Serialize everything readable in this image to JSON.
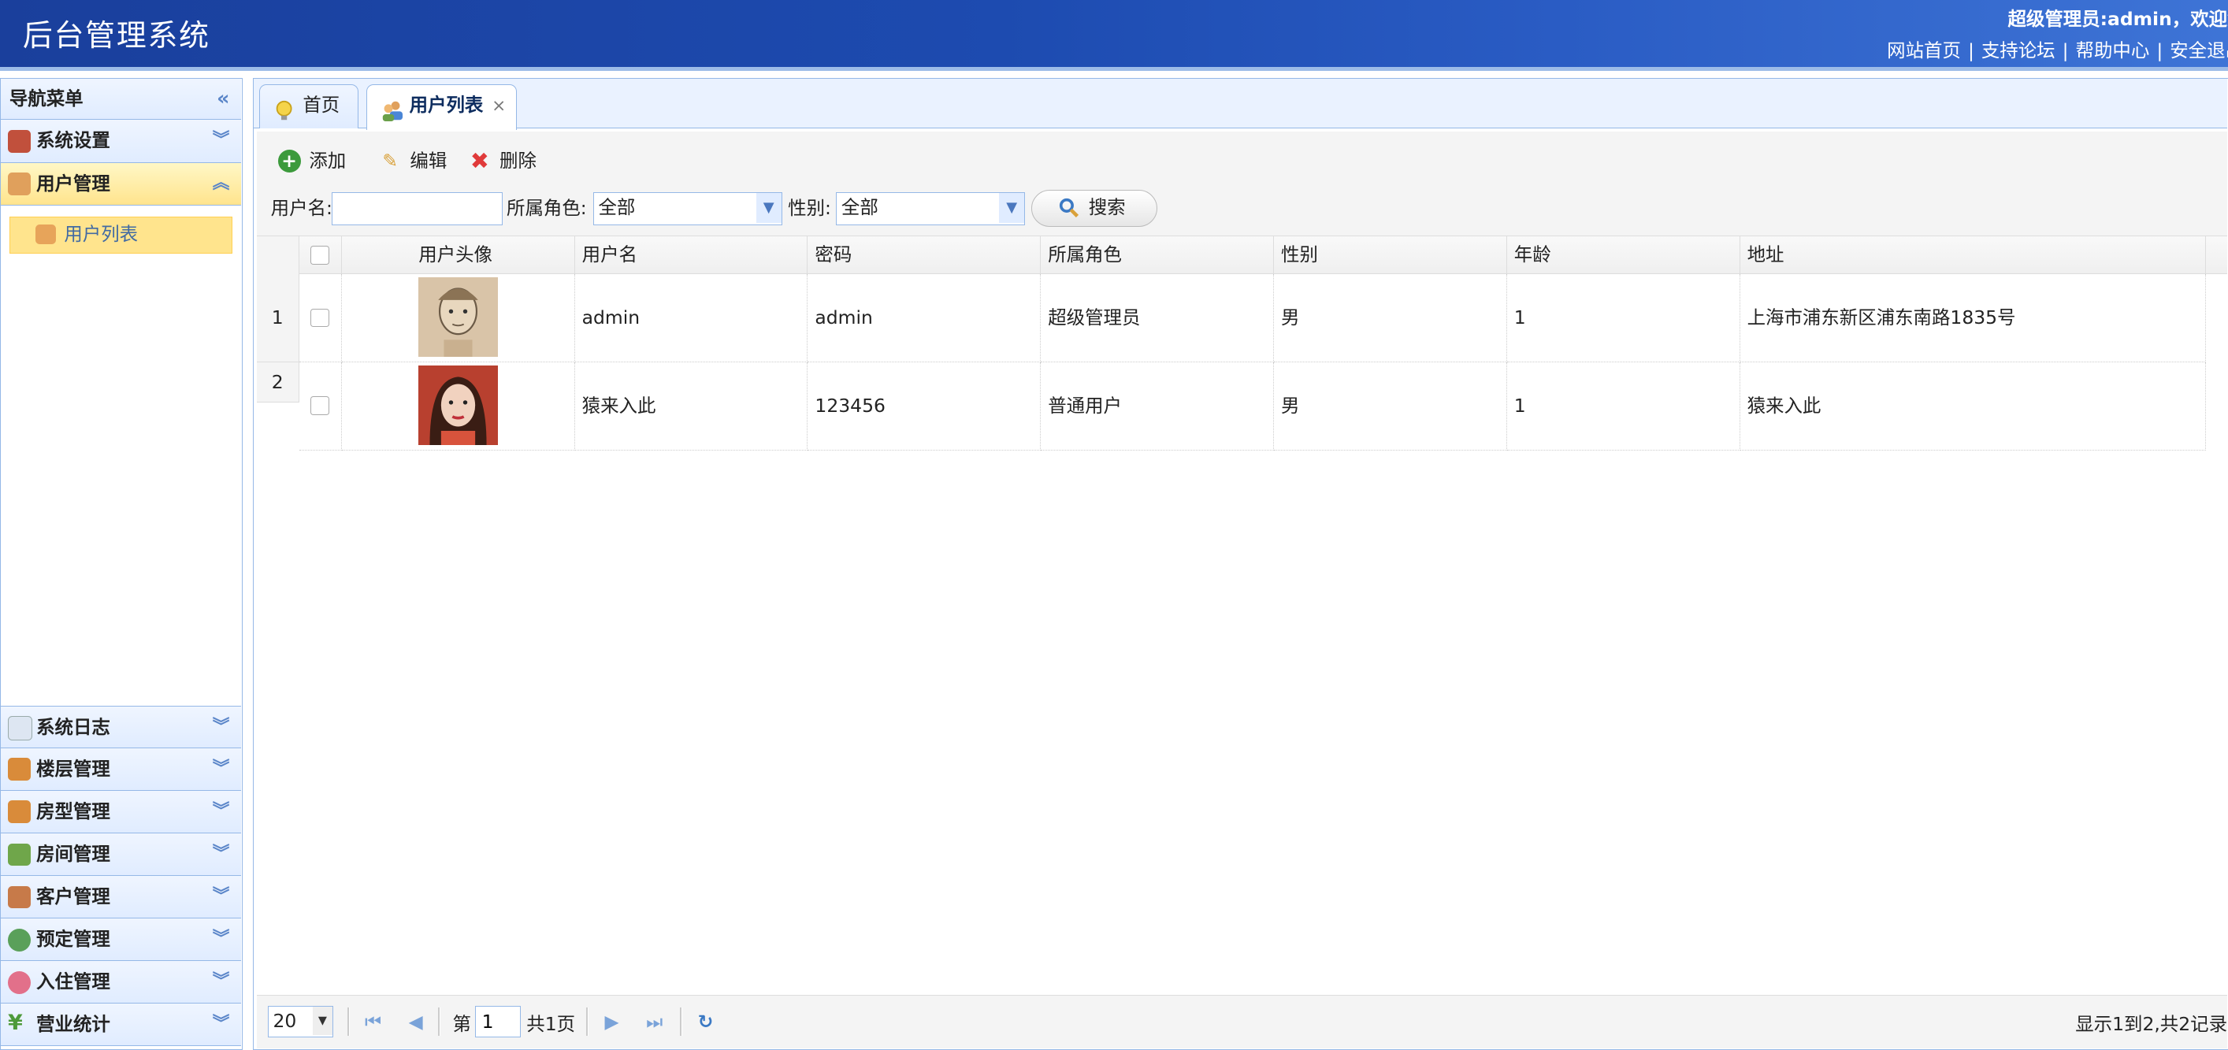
{
  "header": {
    "title": "后台管理系统",
    "welcome": "超级管理员:admin，欢迎您",
    "links": [
      "网站首页",
      "支持论坛",
      "帮助中心",
      "安全退出"
    ]
  },
  "sidebar": {
    "title": "导航菜单",
    "collapse_icon": "double-chevron-left-icon",
    "items_top": [
      {
        "label": "系统设置",
        "icon": "tools-icon",
        "expanded": false
      },
      {
        "label": "用户管理",
        "icon": "users-icon",
        "expanded": true
      }
    ],
    "subitem": {
      "label": "用户列表",
      "icon": "user-list-icon"
    },
    "items_bottom": [
      {
        "label": "系统日志",
        "icon": "log-icon"
      },
      {
        "label": "楼层管理",
        "icon": "building-icon"
      },
      {
        "label": "房型管理",
        "icon": "room-type-icon"
      },
      {
        "label": "房间管理",
        "icon": "room-icon"
      },
      {
        "label": "客户管理",
        "icon": "customer-icon"
      },
      {
        "label": "预定管理",
        "icon": "clock-icon"
      },
      {
        "label": "入住管理",
        "icon": "checkin-icon"
      },
      {
        "label": "营业统计",
        "icon": "yen-icon"
      }
    ]
  },
  "tabs": [
    {
      "label": "首页",
      "icon": "lightbulb-icon",
      "active": false
    },
    {
      "label": "用户列表",
      "icon": "users-icon",
      "active": true,
      "close": "×"
    }
  ],
  "toolbar": {
    "add": "添加",
    "edit": "编辑",
    "delete": "删除"
  },
  "search": {
    "username_label": "用户名:",
    "username_value": "",
    "role_label": "所属角色:",
    "role_value": "全部",
    "gender_label": "性别:",
    "gender_value": "全部",
    "button": "搜索"
  },
  "table": {
    "columns": [
      "用户头像",
      "用户名",
      "密码",
      "所属角色",
      "性别",
      "年龄",
      "地址"
    ],
    "rows": [
      {
        "num": "1",
        "avatar": "sketch-portrait",
        "username": "admin",
        "password": "admin",
        "role": "超级管理员",
        "gender": "男",
        "age": "1",
        "address": "上海市浦东新区浦东南路1835号"
      },
      {
        "num": "2",
        "avatar": "photo-portrait",
        "username": "猿来入此",
        "password": "123456",
        "role": "普通用户",
        "gender": "男",
        "age": "1",
        "address": "猿来入此"
      }
    ]
  },
  "pager": {
    "page_size": "20",
    "page_prefix": "第",
    "page_value": "1",
    "page_total": "共1页",
    "summary": "显示1到2,共2记录"
  },
  "colors": {
    "header_blue": "#1d4bb0",
    "panel_border": "#95b8e7",
    "active_yellow": "#ffe48d"
  }
}
